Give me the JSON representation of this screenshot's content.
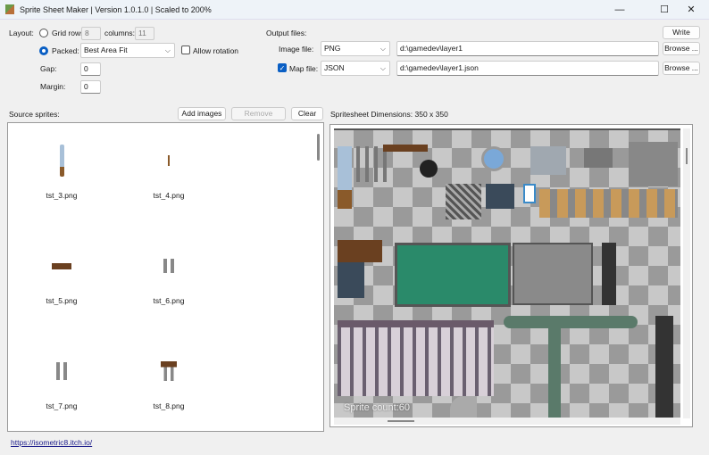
{
  "window": {
    "title": "Sprite Sheet Maker | Version 1.0.1.0 | Scaled to 200%",
    "minimize": "—",
    "maximize": "☐",
    "close": "✕"
  },
  "layout": {
    "label": "Layout:",
    "grid_rows_label": "Grid rows:",
    "grid_rows": "8",
    "columns_label": "columns:",
    "columns": "11",
    "packed_label": "Packed:",
    "packed_selected": true,
    "algorithm": "Best Area Fit",
    "allow_rotation_label": "Allow rotation",
    "allow_rotation": false,
    "gap_label": "Gap:",
    "gap": "0",
    "margin_label": "Margin:",
    "margin": "0"
  },
  "output": {
    "label": "Output files:",
    "write": "Write",
    "image_file_label": "Image file:",
    "image_format": "PNG",
    "image_path": "d:\\gamedev\\layer1",
    "browse": "Browse ...",
    "map_file_label": "Map file:",
    "map_enabled": true,
    "map_format": "JSON",
    "map_path": "d:\\gamedev\\layer1.json"
  },
  "sources": {
    "label": "Source sprites:",
    "add": "Add images",
    "remove": "Remove",
    "clear": "Clear",
    "items": [
      {
        "name": "tst_3.png",
        "icon": "sword-icon"
      },
      {
        "name": "tst_4.png",
        "icon": "stick-icon"
      },
      {
        "name": "tst_5.png",
        "icon": "plank-icon"
      },
      {
        "name": "tst_6.png",
        "icon": "chain-icon"
      },
      {
        "name": "tst_7.png",
        "icon": "chain-icon"
      },
      {
        "name": "tst_8.png",
        "icon": "chain-plank-icon"
      }
    ]
  },
  "preview": {
    "dimensions_label": "Spritesheet Dimensions:",
    "dimensions": "350 x 350",
    "sprite_count": "Sprite count:60"
  },
  "footer": {
    "link": "https://isometric8.itch.io/"
  }
}
